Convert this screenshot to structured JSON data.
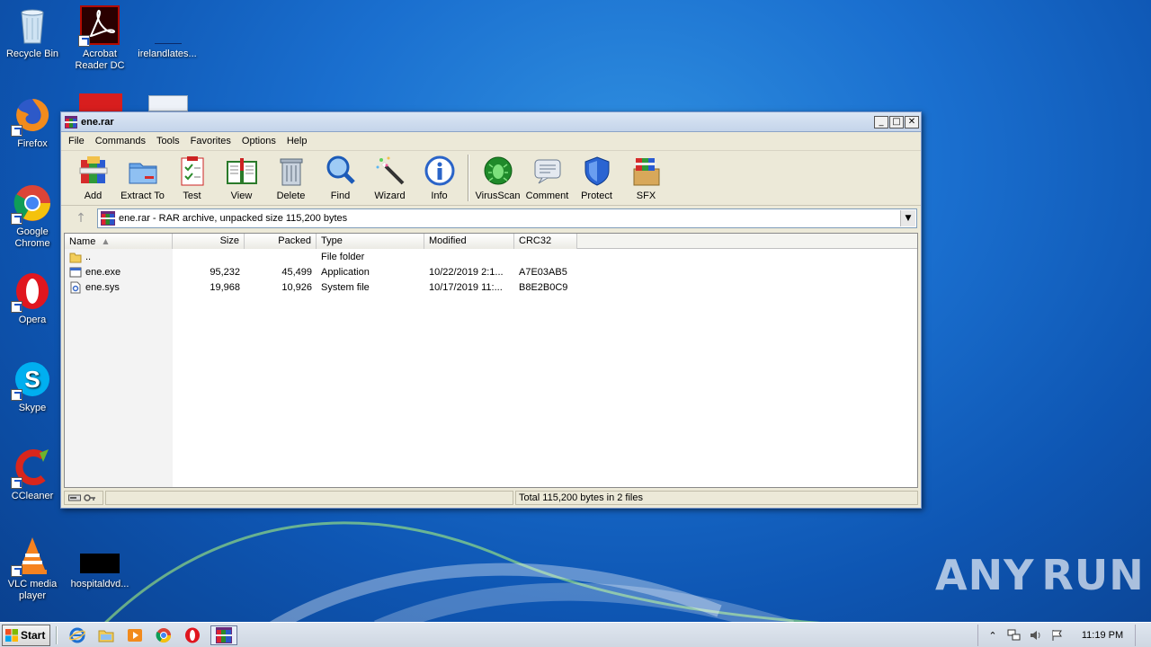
{
  "desktop": {
    "icons": [
      {
        "label": "Recycle Bin",
        "icon": "recycle-bin-icon"
      },
      {
        "label": "Acrobat Reader DC",
        "icon": "acrobat-icon"
      },
      {
        "label": "irelandlates...",
        "icon": "file-icon"
      },
      {
        "label": "Firefox",
        "icon": "firefox-icon"
      },
      {
        "label": "Google Chrome",
        "icon": "chrome-icon"
      },
      {
        "label": "Opera",
        "icon": "opera-icon"
      },
      {
        "label": "Skype",
        "icon": "skype-icon"
      },
      {
        "label": "CCleaner",
        "icon": "ccleaner-icon"
      },
      {
        "label": "VLC media player",
        "icon": "vlc-icon"
      },
      {
        "label": "hospitaldvd...",
        "icon": "file-icon"
      }
    ]
  },
  "window": {
    "title": "ene.rar",
    "menu": [
      "File",
      "Commands",
      "Tools",
      "Favorites",
      "Options",
      "Help"
    ],
    "toolbar": [
      {
        "label": "Add",
        "icon": "add-icon"
      },
      {
        "label": "Extract To",
        "icon": "extract-icon"
      },
      {
        "label": "Test",
        "icon": "test-icon"
      },
      {
        "label": "View",
        "icon": "view-icon"
      },
      {
        "label": "Delete",
        "icon": "delete-icon"
      },
      {
        "label": "Find",
        "icon": "find-icon"
      },
      {
        "label": "Wizard",
        "icon": "wizard-icon"
      },
      {
        "label": "Info",
        "icon": "info-icon"
      },
      {
        "label": "VirusScan",
        "icon": "virusscan-icon"
      },
      {
        "label": "Comment",
        "icon": "comment-icon"
      },
      {
        "label": "Protect",
        "icon": "protect-icon"
      },
      {
        "label": "SFX",
        "icon": "sfx-icon"
      }
    ],
    "address": "ene.rar - RAR archive, unpacked size 115,200 bytes",
    "columns": [
      "Name",
      "Size",
      "Packed",
      "Type",
      "Modified",
      "CRC32"
    ],
    "files": [
      {
        "name": "..",
        "size": "",
        "packed": "",
        "type": "File folder",
        "modified": "",
        "crc": "",
        "icon": "folder-icon"
      },
      {
        "name": "ene.exe",
        "size": "95,232",
        "packed": "45,499",
        "type": "Application",
        "modified": "10/22/2019 2:1...",
        "crc": "A7E03AB5",
        "icon": "exe-icon"
      },
      {
        "name": "ene.sys",
        "size": "19,968",
        "packed": "10,926",
        "type": "System file",
        "modified": "10/17/2019 11:...",
        "crc": "B8E2B0C9",
        "icon": "sys-icon"
      }
    ],
    "status": "Total 115,200 bytes in 2 files"
  },
  "taskbar": {
    "start": "Start",
    "clock": "11:19 PM"
  },
  "watermark": {
    "left": "ANY",
    "right": "RUN"
  }
}
